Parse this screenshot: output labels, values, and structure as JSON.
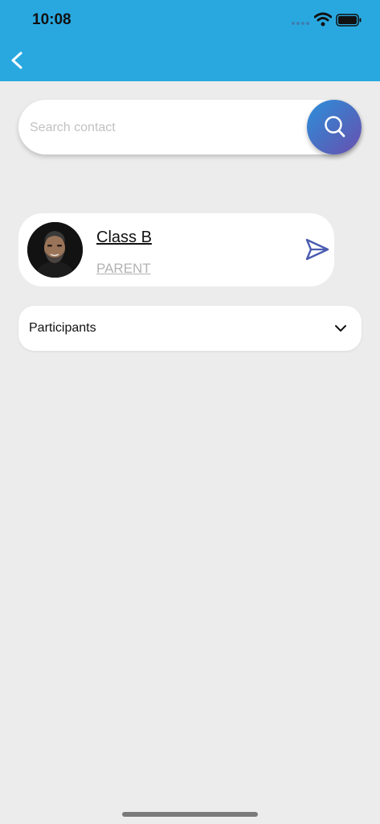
{
  "status_bar": {
    "time": "10:08"
  },
  "header": {
    "back_icon": "chevron-left-icon",
    "background_color": "#29a8e0"
  },
  "search": {
    "placeholder": "Search contact",
    "value": "",
    "button_icon": "search-icon"
  },
  "contact": {
    "name": "Class B",
    "role": "PARENT",
    "avatar_icon": "person-photo",
    "action_icon": "send-icon"
  },
  "participants": {
    "label": "Participants",
    "toggle_icon": "chevron-down-icon"
  }
}
